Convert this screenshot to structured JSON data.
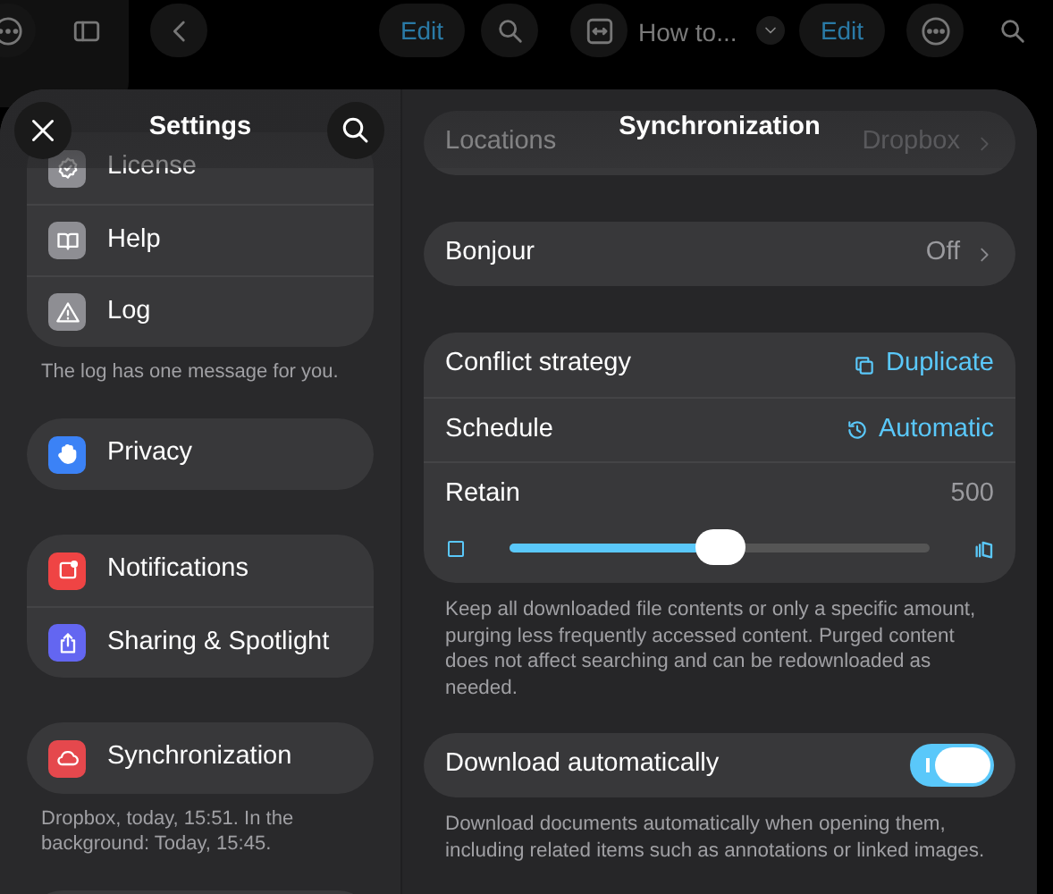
{
  "background_toolbar": {
    "edit_buttons": [
      "Edit",
      "Edit"
    ],
    "document_title": "How to..."
  },
  "sidebar": {
    "title": "Settings",
    "sections": [
      {
        "items": [
          {
            "label": "License",
            "color": "#8e8e93"
          },
          {
            "label": "Help",
            "color": "#8e8e93"
          },
          {
            "label": "Log",
            "color": "#8e8e93"
          }
        ],
        "footer": "The log has one message for you."
      },
      {
        "items": [
          {
            "label": "Privacy",
            "color": "#3b82f6"
          }
        ]
      },
      {
        "items": [
          {
            "label": "Notifications",
            "color": "#ef4444"
          },
          {
            "label": "Sharing & Spotlight",
            "color": "#6366f1"
          }
        ]
      },
      {
        "items": [
          {
            "label": "Synchronization",
            "color": "#e5484d"
          }
        ],
        "footer": "Dropbox, today, 15:51. In the background: Today, 15:45."
      }
    ]
  },
  "detail": {
    "title": "Synchronization",
    "sections": [
      {
        "rows": [
          {
            "kind": "link",
            "label": "Locations",
            "value": "Dropbox"
          }
        ]
      },
      {
        "rows": [
          {
            "kind": "link",
            "label": "Bonjour",
            "value": "Off"
          }
        ]
      },
      {
        "rows": [
          {
            "kind": "menu",
            "label": "Conflict strategy",
            "value": "Duplicate"
          },
          {
            "kind": "menu",
            "label": "Schedule",
            "value": "Automatic"
          },
          {
            "kind": "value",
            "label": "Retain",
            "value": "500"
          },
          {
            "kind": "slider",
            "level": 0.5
          }
        ],
        "footer": "Keep all downloaded file contents or only a specific amount, purging less frequently accessed content. Purged content does not affect searching and can be redownloaded as needed."
      },
      {
        "rows": [
          {
            "kind": "toggle",
            "label": "Download automatically",
            "on": true
          }
        ],
        "footer": "Download documents automatically when opening them, including related items such as annotations or linked images."
      }
    ]
  }
}
